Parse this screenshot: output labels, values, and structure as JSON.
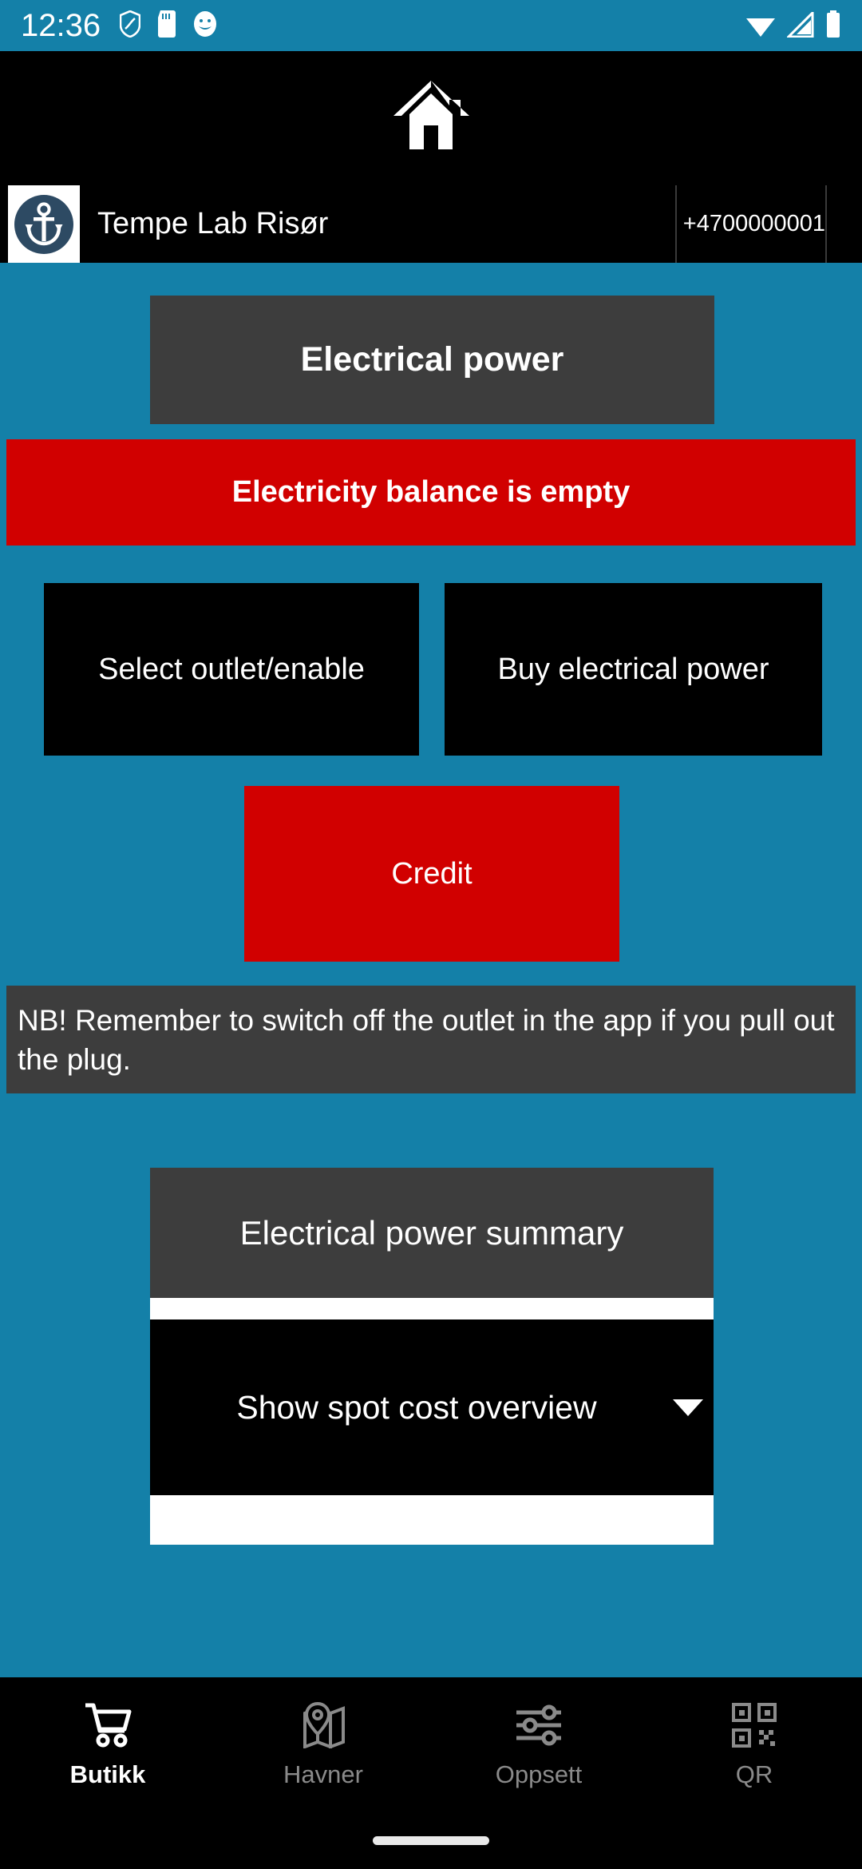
{
  "status_bar": {
    "time": "12:36",
    "left_icons": [
      "shield-icon",
      "sd-card-icon",
      "app-badge-icon"
    ],
    "right_icons": [
      "wifi-icon",
      "cellular-signal-icon",
      "battery-icon"
    ]
  },
  "app_bar": {
    "home_icon": "home-icon"
  },
  "harbour": {
    "logo_icon": "anchor-logo-icon",
    "name": "Tempe Lab Risør",
    "phone": "+4700000001"
  },
  "main": {
    "page_title": "Electrical power",
    "balance_banner": "Electricity balance is empty",
    "buttons": {
      "select_outlet": "Select outlet/enable",
      "buy_power": "Buy electrical power",
      "credit": "Credit"
    },
    "note": "NB! Remember to switch off the outlet in the app if you pull out the plug.",
    "summary_title": "Electrical power summary",
    "spot_dropdown": {
      "selected": "Show spot cost overview",
      "arrow_icon": "chevron-down-icon"
    }
  },
  "bottom_nav": {
    "items": [
      {
        "label": "Butikk",
        "icon": "shopping-cart-icon",
        "active": true
      },
      {
        "label": "Havner",
        "icon": "map-pin-icon",
        "active": false
      },
      {
        "label": "Oppsett",
        "icon": "sliders-icon",
        "active": false
      },
      {
        "label": "QR",
        "icon": "qr-code-icon",
        "active": false
      }
    ]
  },
  "colors": {
    "background_teal": "#1480a8",
    "card_dark_gray": "#3d3d3d",
    "alert_red": "#d10000",
    "black": "#000000",
    "white": "#ffffff",
    "nav_inactive_gray": "#8a8a8a",
    "logo_navy": "#2d4a63"
  }
}
